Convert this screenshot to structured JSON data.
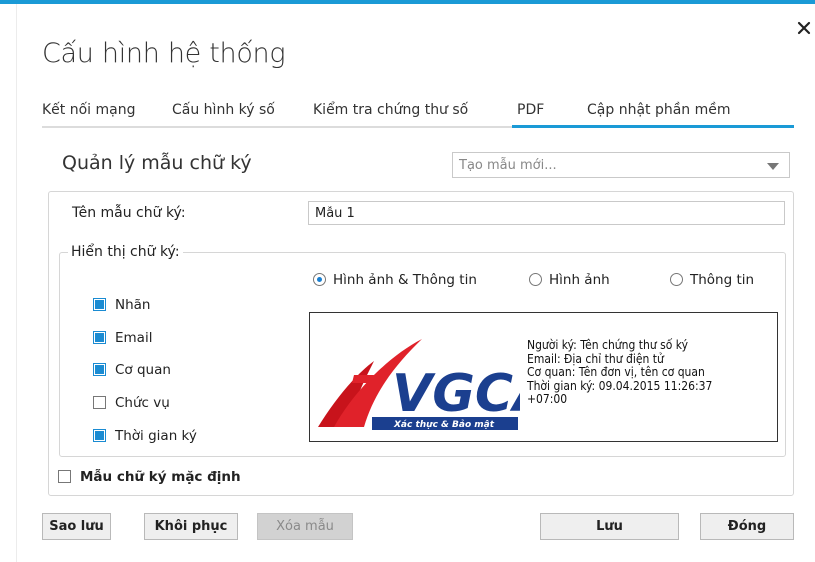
{
  "dialog": {
    "title": "Cấu hình hệ thống",
    "close_icon": "close-icon",
    "accent_color": "#1a9ad6"
  },
  "tabs": [
    {
      "label": "Kết nối mạng",
      "active": false
    },
    {
      "label": "Cấu hình ký số",
      "active": false
    },
    {
      "label": "Kiểm tra chứng thư số",
      "active": false
    },
    {
      "label": "PDF",
      "active": true
    },
    {
      "label": "Cập nhật phần mềm",
      "active": false
    }
  ],
  "template_manager": {
    "title": "Quản lý mẫu chữ ký",
    "dropdown_placeholder": "Tạo mẫu mới..."
  },
  "form": {
    "name_label": "Tên mẫu chữ ký:",
    "name_value": "Mẫu 1",
    "display_group_label": "Hiển thị chữ ký:",
    "display_modes": [
      {
        "label": "Hình ảnh & Thông tin",
        "selected": true
      },
      {
        "label": "Hình ảnh",
        "selected": false
      },
      {
        "label": "Thông tin",
        "selected": false
      }
    ],
    "fields": [
      {
        "label": "Nhãn",
        "checked": true
      },
      {
        "label": "Email",
        "checked": true
      },
      {
        "label": "Cơ quan",
        "checked": true
      },
      {
        "label": "Chức vụ",
        "checked": false
      },
      {
        "label": "Thời gian ký",
        "checked": true
      }
    ],
    "default_label": "Mẫu chữ ký mặc định",
    "default_checked": false
  },
  "preview": {
    "logo_text": "VGCA",
    "logo_tagline": "Xác thực & Bảo mật",
    "lines": [
      "Người ký: Tên chứng thư số ký",
      "Email: Địa chỉ thư điện tử",
      "Cơ quan: Tên đơn vị, tên cơ quan",
      "Thời gian ký: 09.04.2015 11:26:37",
      "+07:00"
    ]
  },
  "buttons": {
    "backup": "Sao lưu",
    "restore": "Khôi phục",
    "delete": "Xóa mẫu",
    "save": "Lưu",
    "close": "Đóng"
  }
}
